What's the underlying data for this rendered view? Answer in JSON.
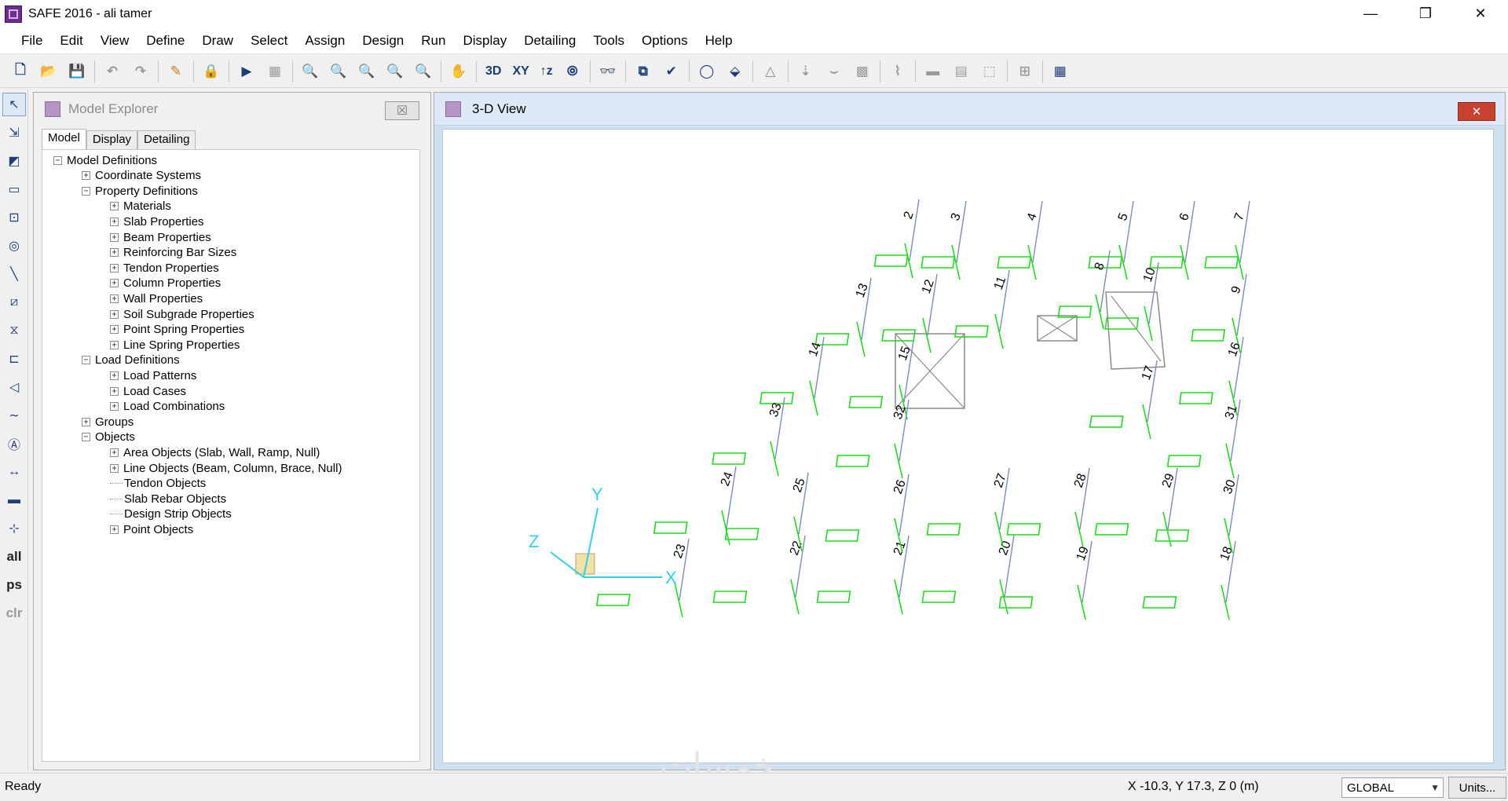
{
  "window": {
    "title": "SAFE 2016 - ali tamer",
    "minimize": "—",
    "restore": "❐",
    "close": "✕"
  },
  "menu": [
    "File",
    "Edit",
    "View",
    "Define",
    "Draw",
    "Select",
    "Assign",
    "Design",
    "Run",
    "Display",
    "Detailing",
    "Tools",
    "Options",
    "Help"
  ],
  "toolbar": {
    "view_3d": "3D",
    "view_xy": "XY",
    "view_z": "↑z"
  },
  "left_toolbar": {
    "all": "all",
    "ps": "ps",
    "clr": "clr"
  },
  "explorer": {
    "title": "Model Explorer",
    "tabs": [
      "Model",
      "Display",
      "Detailing"
    ],
    "tree": [
      {
        "label": "Model Definitions",
        "level": 0,
        "toggle": "−"
      },
      {
        "label": "Coordinate Systems",
        "level": 1,
        "toggle": "+"
      },
      {
        "label": "Property Definitions",
        "level": 1,
        "toggle": "−"
      },
      {
        "label": "Materials",
        "level": 2,
        "toggle": "+"
      },
      {
        "label": "Slab Properties",
        "level": 2,
        "toggle": "+"
      },
      {
        "label": "Beam Properties",
        "level": 2,
        "toggle": "+"
      },
      {
        "label": "Reinforcing Bar Sizes",
        "level": 2,
        "toggle": "+"
      },
      {
        "label": "Tendon Properties",
        "level": 2,
        "toggle": "+"
      },
      {
        "label": "Column Properties",
        "level": 2,
        "toggle": "+"
      },
      {
        "label": "Wall Properties",
        "level": 2,
        "toggle": "+"
      },
      {
        "label": "Soil Subgrade Properties",
        "level": 2,
        "toggle": "+"
      },
      {
        "label": "Point Spring Properties",
        "level": 2,
        "toggle": "+"
      },
      {
        "label": "Line Spring Properties",
        "level": 2,
        "toggle": "+"
      },
      {
        "label": "Load Definitions",
        "level": 1,
        "toggle": "−"
      },
      {
        "label": "Load Patterns",
        "level": 2,
        "toggle": "+"
      },
      {
        "label": "Load Cases",
        "level": 2,
        "toggle": "+"
      },
      {
        "label": "Load Combinations",
        "level": 2,
        "toggle": "+"
      },
      {
        "label": "Groups",
        "level": 1,
        "toggle": "+"
      },
      {
        "label": "Objects",
        "level": 1,
        "toggle": "−"
      },
      {
        "label": "Area Objects (Slab, Wall, Ramp, Null)",
        "level": 2,
        "toggle": "+"
      },
      {
        "label": "Line Objects (Beam, Column, Brace, Null)",
        "level": 2,
        "toggle": "+"
      },
      {
        "label": "Tendon Objects",
        "level": 2,
        "toggle": ""
      },
      {
        "label": "Slab Rebar Objects",
        "level": 2,
        "toggle": ""
      },
      {
        "label": "Design Strip Objects",
        "level": 2,
        "toggle": ""
      },
      {
        "label": "Point Objects",
        "level": 2,
        "toggle": "+"
      }
    ]
  },
  "view": {
    "title": "3-D View",
    "axes": {
      "x": "X",
      "y": "Y",
      "z": "Z"
    },
    "columns": [
      "2",
      "3",
      "4",
      "5",
      "6",
      "7",
      "8",
      "9",
      "10",
      "11",
      "12",
      "13",
      "14",
      "15",
      "16",
      "17",
      "18",
      "19",
      "20",
      "21",
      "22",
      "23",
      "24",
      "25",
      "26",
      "27",
      "28",
      "29",
      "30",
      "31",
      "32",
      "33"
    ]
  },
  "status": {
    "ready": "Ready",
    "coords": "X -10.3,  Y 17.3,  Z 0  (m)",
    "coord_system": "GLOBAL",
    "units_button": "Units..."
  },
  "watermark": "خمسات"
}
